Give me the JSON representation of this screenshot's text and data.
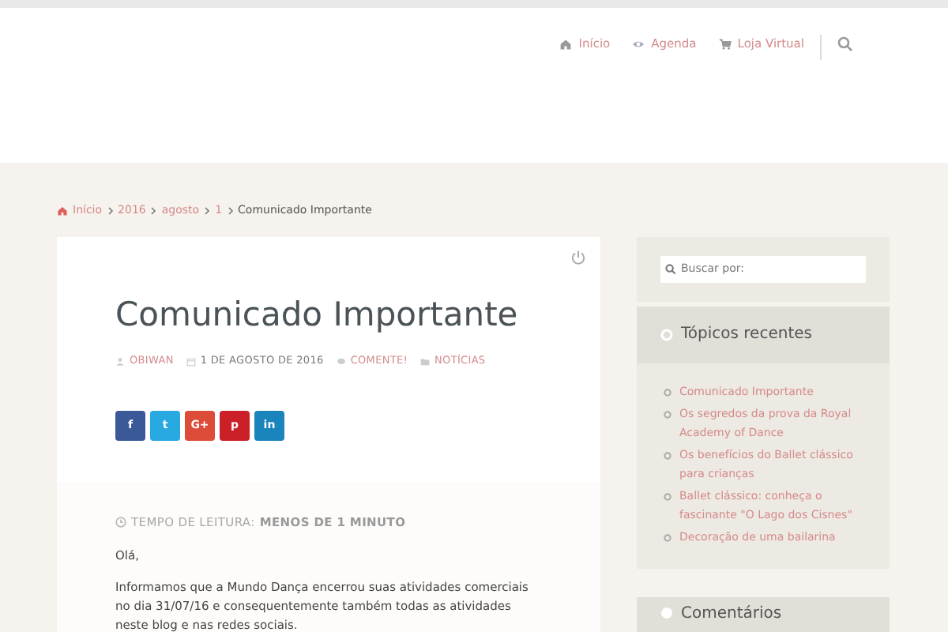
{
  "nav": [
    {
      "label": "Início"
    },
    {
      "label": "Agenda"
    },
    {
      "label": "Loja Virtual"
    }
  ],
  "breadcrumb": [
    "Início",
    "2016",
    "agosto",
    "1",
    "Comunicado Importante"
  ],
  "post": {
    "title": "Comunicado Importante",
    "meta": [
      {
        "text": "OBIWAN",
        "link": true
      },
      {
        "text": "1 DE AGOSTO DE 2016",
        "link": false
      },
      {
        "text": "COMENTE!",
        "link": true
      },
      {
        "text": "NOTÍCIAS",
        "link": true
      }
    ],
    "share": [
      {
        "label": "f",
        "color": "#3b5998"
      },
      {
        "label": "t",
        "color": "#29a9e1"
      },
      {
        "label": "G+",
        "color": "#dd4b39"
      },
      {
        "label": "p",
        "color": "#cb2027"
      },
      {
        "label": "in",
        "color": "#1a84bc"
      }
    ],
    "reading_label": "TEMPO DE LEITURA:",
    "reading_value": "MENOS DE 1 MINUTO",
    "paragraphs": [
      "Olá,",
      "Informamos que a Mundo Dança encerrou suas atividades comerciais no dia 31/07/16 e consequentemente também todas as atividades neste blog e nas redes sociais."
    ]
  },
  "search": {
    "placeholder": "Buscar por:"
  },
  "recent": {
    "title": "Tópicos recentes",
    "items": [
      "Comunicado Importante",
      "Os segredos da prova da Royal Academy of Dance",
      "Os benefícios do Ballet clássico para crianças",
      "Ballet clássico: conheça o fascinante \"O Lago dos Cisnes\"",
      "Decoração de uma bailarina"
    ]
  },
  "comments": {
    "title": "Comentários"
  }
}
